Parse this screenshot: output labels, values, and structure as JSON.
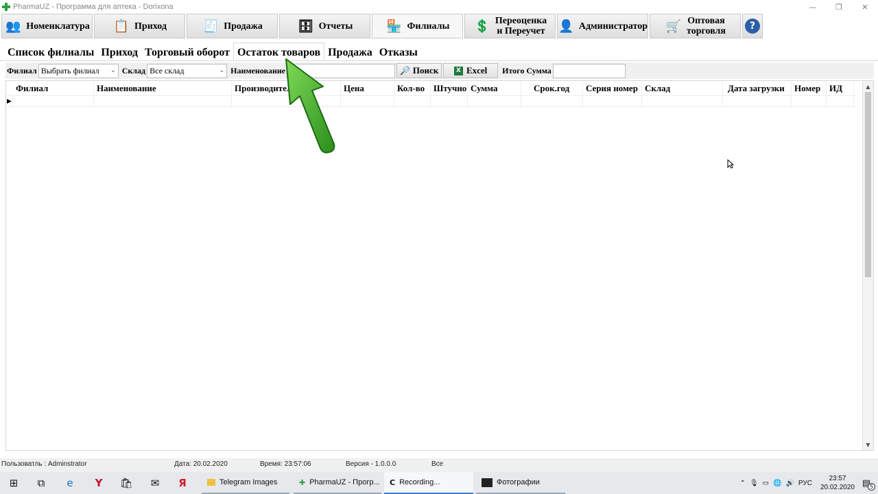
{
  "window": {
    "title": "PharmaUZ - Программа для аптека - Dorixona",
    "controls": [
      "—",
      "❐",
      "✕"
    ]
  },
  "toolbar": {
    "items": [
      {
        "label": "Номенклатура",
        "icon": "people-icon"
      },
      {
        "label": "Приход",
        "icon": "clipboard-icon"
      },
      {
        "label": "Продажа",
        "icon": "receipt-icon"
      },
      {
        "label": "Отчеты",
        "icon": "cabinet-icon"
      },
      {
        "label": "Филиалы",
        "icon": "pharmacy-icon"
      },
      {
        "label": "Переоценка\nи Переучет",
        "icon": "money-icon"
      },
      {
        "label": "Администратор",
        "icon": "admin-icon"
      },
      {
        "label": "Оптовая\nторговля",
        "icon": "cart-icon"
      }
    ],
    "help": "?"
  },
  "subtabs": [
    "Список филиалы",
    "Приход",
    "Торговый оборот",
    "Остаток товаров",
    "Продажа",
    "Отказы"
  ],
  "filters": {
    "branch_label": "Филиал",
    "branch_value": "Выбрать филиал",
    "warehouse_label": "Склад",
    "warehouse_value": "Все склад",
    "name_label": "Наименование",
    "name_value": "",
    "search_label": "Поиск",
    "excel_label": "Excel",
    "total_label": "Итого Сумма",
    "total_value": ""
  },
  "grid": {
    "columns": [
      "Филиал",
      "Наименование",
      "Производитель",
      "Цена",
      "Кол-во",
      "Штучно",
      "Сумма",
      "Срок.год",
      "Серия номер",
      "Склад",
      "Дата загрузки",
      "Номер",
      "ИД"
    ]
  },
  "status": {
    "user": "Пользоватль : Adminstrator",
    "date": "Дата: 20.02.2020",
    "time": "Время: 23:57:06",
    "version": "Версия - 1.0.0.0",
    "scope": "Все"
  },
  "taskbar": {
    "apps": [
      {
        "label": "Telegram Images"
      },
      {
        "label": "PharmaUZ - Прогр..."
      },
      {
        "label": "Recording..."
      },
      {
        "label": "Фотографии"
      }
    ],
    "lang": "РУС",
    "time": "23:57",
    "date": "20.02.2020",
    "notifications": "5"
  },
  "colors": {
    "accent": "#3a7bd5",
    "arrow": "#3fae2a",
    "help": "#2d5fa8"
  }
}
